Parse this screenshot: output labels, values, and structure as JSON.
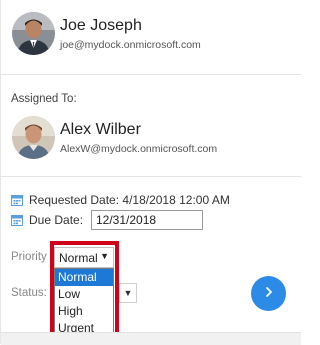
{
  "requester": {
    "name": "Joe Joseph",
    "email": "joe@mydock.onmicrosoft.com"
  },
  "assigned_to_label": "Assigned To:",
  "assignee": {
    "name": "Alex Wilber",
    "email": "AlexW@mydock.onmicrosoft.com"
  },
  "requested_date": "Requested Date: 4/18/2018 12:00 AM",
  "due_date": {
    "label": "Due Date:",
    "value": "12/31/2018"
  },
  "priority": {
    "label": "Priority",
    "selected": "Normal",
    "caret": "▼",
    "options": [
      "Normal",
      "Low",
      "High",
      "Urgent"
    ]
  },
  "status": {
    "label": "Status:",
    "caret": "▼"
  },
  "colors": {
    "accent": "#2b8be6",
    "highlight": "#d0021b",
    "selected_option": "#1e78d6"
  },
  "icons": {
    "calendar": "calendar-icon",
    "next": "chevron-right-icon"
  }
}
